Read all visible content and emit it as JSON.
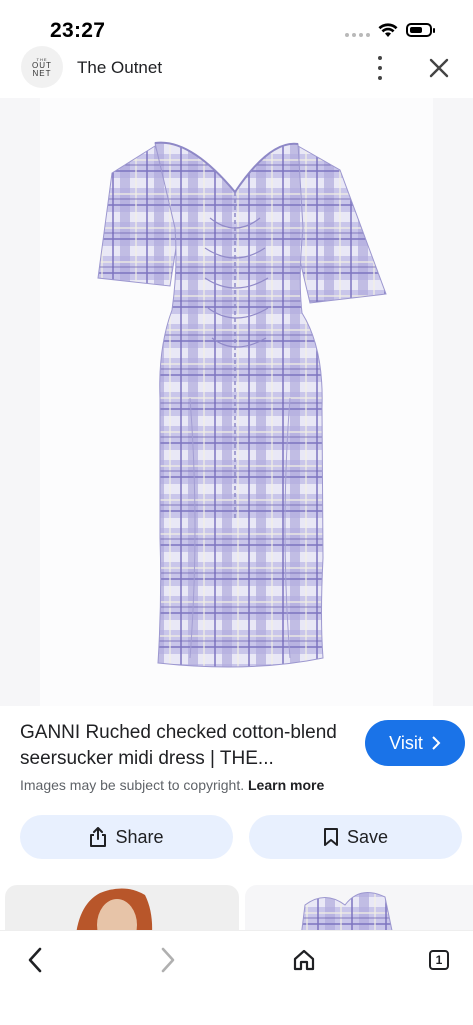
{
  "status_bar": {
    "time": "23:27"
  },
  "header": {
    "logo_lines": [
      "THE",
      "OUT",
      "NET"
    ],
    "site_name": "The Outnet"
  },
  "product": {
    "title": "GANNI Ruched checked cotton-blend seersucker midi dress | THE...",
    "copyright_text": "Images may be subject to copyright.",
    "learn_more": "Learn more",
    "visit_label": "Visit",
    "dress_colors": {
      "base": "#bdb9e6",
      "check": "#8a82c7",
      "light": "#ecebf7"
    }
  },
  "actions": {
    "share_label": "Share",
    "save_label": "Save"
  },
  "bottom_nav": {
    "tab_count": "1"
  }
}
